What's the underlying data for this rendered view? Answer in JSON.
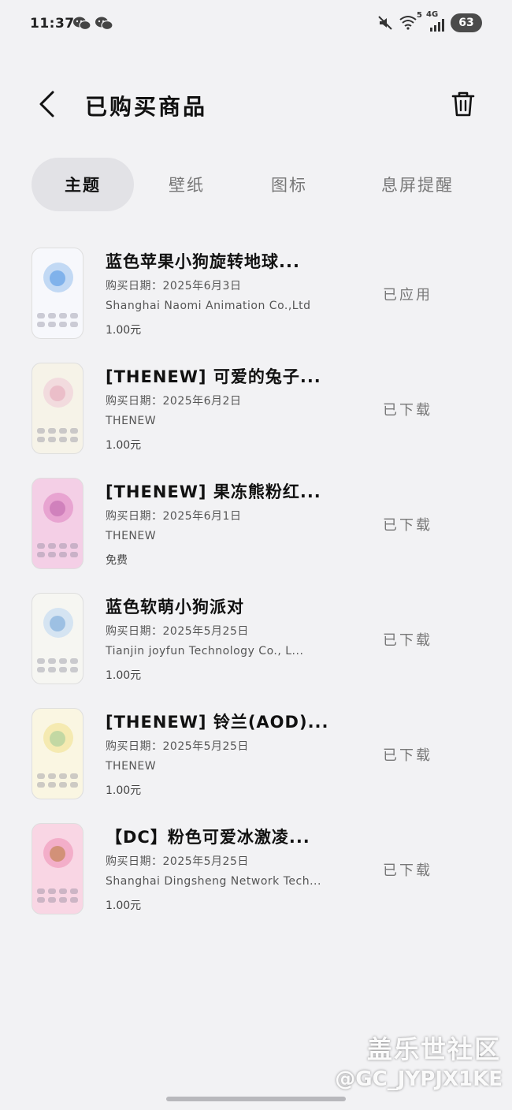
{
  "status_bar": {
    "time": "11:37",
    "network": "4G",
    "wifi_badge": "5",
    "battery": "63",
    "icons": [
      "wechat-icon",
      "wechat-icon",
      "mute-icon",
      "wifi-icon",
      "cellular-signal-icon"
    ]
  },
  "header": {
    "title": "已购买商品",
    "back_icon": "chevron-left-icon",
    "delete_icon": "trash-icon"
  },
  "tabs": [
    {
      "label": "主题",
      "active": true
    },
    {
      "label": "壁纸",
      "active": false
    },
    {
      "label": "图标",
      "active": false
    },
    {
      "label": "息屏提醒",
      "active": false
    }
  ],
  "items": [
    {
      "title": "蓝色苹果小狗旋转地球...",
      "date": "购买日期：2025年6月3日",
      "vendor": "Shanghai Naomi Animation Co.,Ltd",
      "price": "1.00元",
      "status": "已应用",
      "thumb_colors": [
        "#f7f8fc",
        "#b9d3f2",
        "#6fa8e8"
      ]
    },
    {
      "title": "[THENEW] 可爱的兔子...",
      "date": "购买日期：2025年6月2日",
      "vendor": "THENEW",
      "price": "1.00元",
      "status": "已下载",
      "thumb_colors": [
        "#f6f3e8",
        "#f1d6dc",
        "#e8b7c3"
      ]
    },
    {
      "title": "[THENEW] 果冻熊粉红...",
      "date": "购买日期：2025年6月1日",
      "vendor": "THENEW",
      "price": "免费",
      "status": "已下载",
      "thumb_colors": [
        "#f4cfe6",
        "#e59ccd",
        "#c978b6"
      ]
    },
    {
      "title": "蓝色软萌小狗派对",
      "date": "购买日期：2025年5月25日",
      "vendor": "Tianjin joyfun Technology Co., L...",
      "price": "1.00元",
      "status": "已下载",
      "thumb_colors": [
        "#f6f6f2",
        "#cfe0f2",
        "#8eb6df"
      ]
    },
    {
      "title": "[THENEW] 铃兰(AOD)...",
      "date": "购买日期：2025年5月25日",
      "vendor": "THENEW",
      "price": "1.00元",
      "status": "已下载",
      "thumb_colors": [
        "#faf6e2",
        "#f3e7a8",
        "#b6d3a0"
      ]
    },
    {
      "title": "【DC】粉色可爱冰激凌...",
      "date": "购买日期：2025年5月25日",
      "vendor": "Shanghai Dingsheng Network Tech...",
      "price": "1.00元",
      "status": "已下载",
      "thumb_colors": [
        "#f9d6e4",
        "#f2a7c4",
        "#c98a64"
      ]
    }
  ],
  "watermark": {
    "line1": "盖乐世社区",
    "line2": "@GC_JYPJX1KE"
  }
}
